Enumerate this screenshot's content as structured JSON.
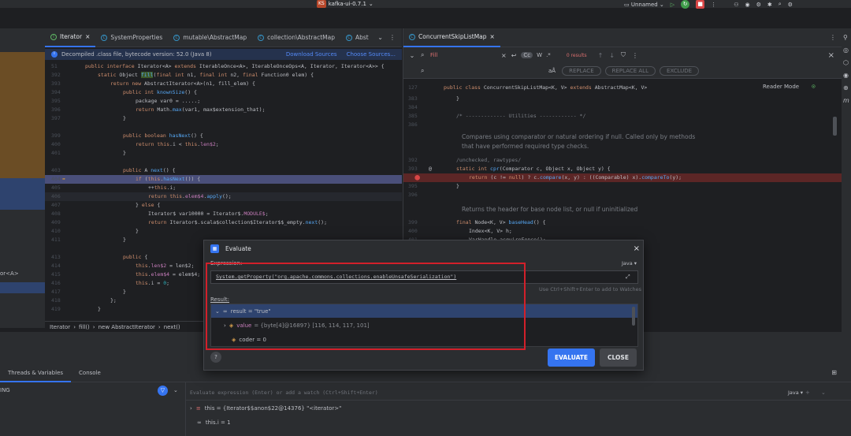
{
  "titlebar": {
    "project_badge": "KS",
    "project_name": "kafka-ui-0.7.1",
    "run_config": "Unnamed"
  },
  "editor_left": {
    "tabs": [
      "Iterator",
      "SystemProperties",
      "mutable\\AbstractMap",
      "collection\\AbstractMap",
      "Abst"
    ],
    "banner_text": "Decompiled .class file, bytecode version: 52.0 (Java 8)",
    "download_sources": "Download Sources",
    "choose_sources": "Choose Sources...",
    "breadcrumb": [
      "Iterator",
      "fill()",
      "new AbstractIterator",
      "next()"
    ]
  },
  "editor_right": {
    "tab": "ConcurrentSkipListMap",
    "find": {
      "search_text": "Fill",
      "results": "0 results",
      "cc": "Cc",
      "w": "W",
      "regex": ".*",
      "replace_btn": "REPLACE",
      "replace_all_btn": "REPLACE ALL",
      "exclude_btn": "EXCLUDE",
      "reader_mode": "Reader Mode"
    },
    "doc1": "Compares using comparator or natural ordering if null. Called only by methods",
    "doc2": "that have performed required type checks.",
    "doc3": "Returns the header for base node list, or null if uninitialized"
  },
  "evaluate_dialog": {
    "title": "Evaluate",
    "expression_label": "Expression:",
    "lang": "Java ▾",
    "expression": "System.getProperty(\"org.apache.commons.collections.enableUnsafeSerialization\")",
    "hint": "Use Ctrl+Shift+Enter to add to Watches",
    "result_label": "Result:",
    "result_root": "result = \"true\"",
    "result_value_name": "value",
    "result_value_detail": "= {byte[4]@16897} [116, 114, 117, 101]",
    "result_coder": "coder = 0",
    "evaluate_btn": "EVALUATE",
    "close_btn": "CLOSE",
    "help": "?"
  },
  "debug": {
    "tabs": [
      "Threads & Variables",
      "Console"
    ],
    "thread_state": "ING",
    "input_placeholder": "Evaluate expression (Enter) or add a watch (Ctrl+Shift+Enter)",
    "lang": "Java ▾",
    "var1": "this = {Iterator$$anon$22@14376} \"<iterator>\"",
    "var2": "this.i = 1",
    "left_trunc": "or<A>"
  },
  "colors": {
    "accent": "#3574f0",
    "highlight_red": "#d2202a",
    "background": "#1e1f22"
  }
}
